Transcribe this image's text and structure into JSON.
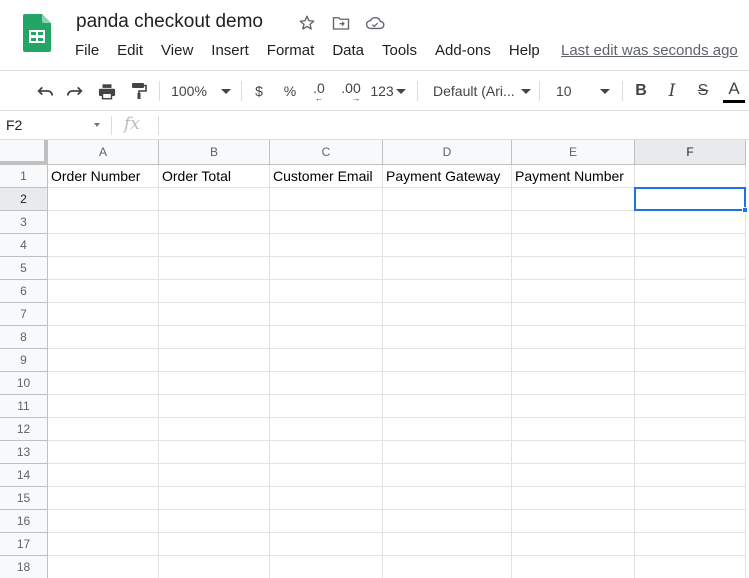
{
  "app": {
    "doc_title": "panda checkout demo",
    "last_edit": "Last edit was seconds ago"
  },
  "menu": [
    "File",
    "Edit",
    "View",
    "Insert",
    "Format",
    "Data",
    "Tools",
    "Add-ons",
    "Help"
  ],
  "toolbar": {
    "zoom": "100%",
    "currency": "$",
    "percent": "%",
    "dec_decrease": ".0",
    "dec_increase": ".00",
    "more_formats": "123",
    "font": "Default (Ari...",
    "font_size": "10",
    "bold": "B",
    "italic": "I",
    "strike": "S",
    "text_color": "A"
  },
  "formula_bar": {
    "name_box": "F2",
    "fx": "fx",
    "value": ""
  },
  "grid": {
    "columns": [
      "A",
      "B",
      "C",
      "D",
      "E",
      "F"
    ],
    "rows": [
      "1",
      "2",
      "3",
      "4",
      "5",
      "6",
      "7",
      "8",
      "9",
      "10",
      "11",
      "12",
      "13",
      "14",
      "15",
      "16",
      "17",
      "18"
    ],
    "row1": [
      "Order Number",
      "Order Total",
      "Customer Email",
      "Payment Gateway",
      "Payment Number",
      ""
    ],
    "selected_cell": "F2"
  },
  "colors": {
    "selection": "#1a73e8",
    "sheets_green": "#0f9d58"
  }
}
